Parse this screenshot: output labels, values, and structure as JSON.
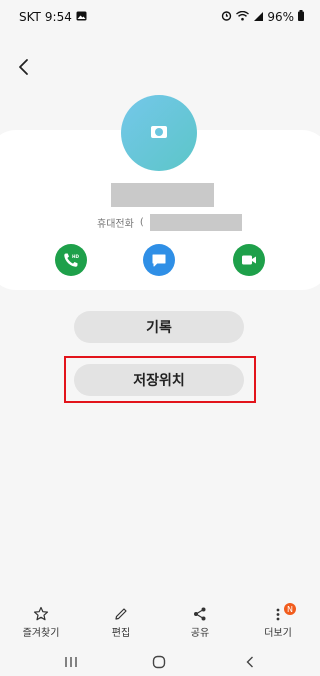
{
  "status_bar": {
    "carrier": "SKT",
    "time": "9:54",
    "battery": "96%",
    "icons": [
      "gallery-icon",
      "alarm-icon",
      "wifi-icon",
      "signal-icon",
      "battery-icon"
    ]
  },
  "header": {
    "back_icon": "chevron-left-icon"
  },
  "contact": {
    "phone_label": "휴대전화",
    "phone_bracket": "(",
    "avatar_icon": "camera-icon",
    "colors": {
      "avatar": "#6bc6df",
      "call": "#1ea04a",
      "message": "#2f8fe6",
      "video": "#1ea04a"
    },
    "actions": [
      {
        "name": "call",
        "icon": "phone-hd-icon"
      },
      {
        "name": "message",
        "icon": "chat-bubble-icon"
      },
      {
        "name": "video",
        "icon": "video-camera-icon"
      }
    ]
  },
  "buttons": {
    "history": "기록",
    "storage": "저장위치"
  },
  "highlight_color": "#e2141b",
  "bottom_bar": {
    "items": [
      {
        "label": "즐겨찾기",
        "icon": "star-icon"
      },
      {
        "label": "편집",
        "icon": "pencil-icon"
      },
      {
        "label": "공유",
        "icon": "share-icon"
      },
      {
        "label": "더보기",
        "icon": "more-vertical-icon",
        "badge": "N"
      }
    ]
  },
  "nav_bar": {
    "icons": [
      "recent-apps-icon",
      "home-icon",
      "back-icon"
    ]
  }
}
